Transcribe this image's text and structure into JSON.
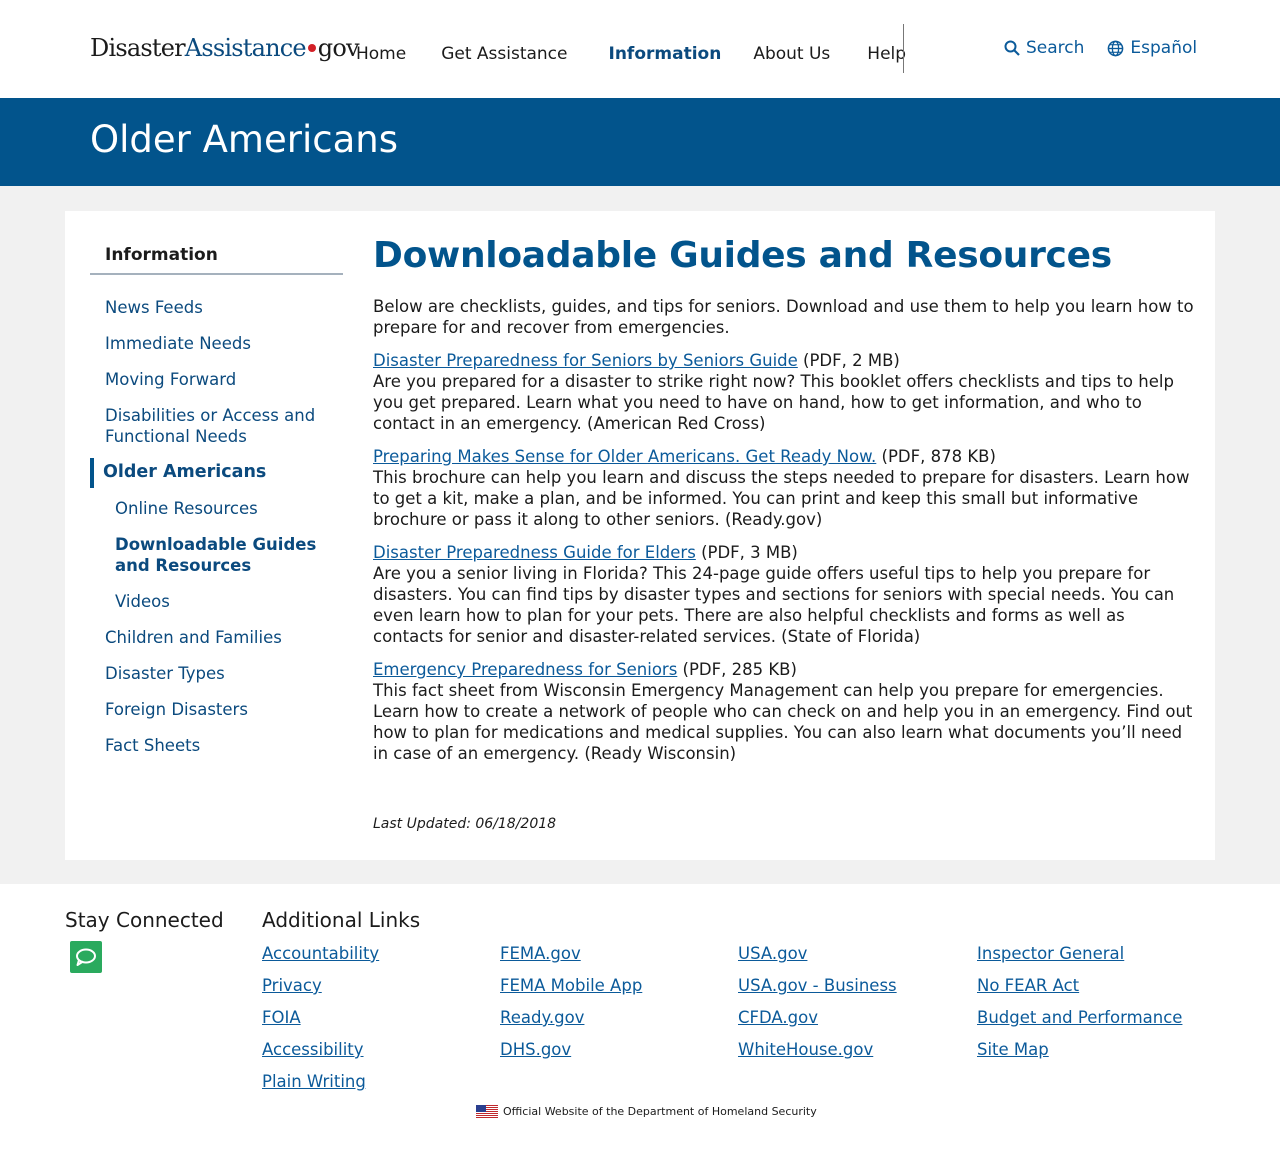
{
  "header": {
    "logo": {
      "part1": "Disaster",
      "part2": "Assistance",
      "part3": "gov"
    },
    "nav": [
      "Home",
      "Get Assistance",
      "Information",
      "About Us",
      "Help"
    ],
    "active_nav": "Information",
    "search_label": "Search",
    "language_label": "Español"
  },
  "banner": {
    "title": "Older Americans"
  },
  "sidebar": {
    "heading": "Information",
    "items": [
      {
        "label": "News Feeds"
      },
      {
        "label": "Immediate Needs"
      },
      {
        "label": "Moving Forward"
      },
      {
        "label": "Disabilities or Access and Functional Needs"
      },
      {
        "label": "Older Americans"
      },
      {
        "label": "Online Resources"
      },
      {
        "label": "Downloadable Guides and Resources"
      },
      {
        "label": "Videos"
      },
      {
        "label": "Children and Families"
      },
      {
        "label": "Disaster Types"
      },
      {
        "label": "Foreign Disasters"
      },
      {
        "label": "Fact Sheets"
      }
    ]
  },
  "main": {
    "title": "Downloadable Guides and Resources",
    "intro": "Below are checklists, guides, and tips for seniors. Download and use them to help you learn how to prepare for and recover from emergencies.",
    "resources": [
      {
        "link": "Disaster Preparedness for Seniors by Seniors Guide",
        "meta": "(PDF, 2 MB)",
        "desc": "Are you prepared for a disaster to strike right now? This booklet offers checklists and tips to help you get prepared. Learn what you need to have on hand, how to get information, and who to contact in an emergency. (American Red Cross)"
      },
      {
        "link": "Preparing Makes Sense for Older Americans. Get Ready Now.",
        "meta": "(PDF, 878 KB)",
        "desc": "This brochure can help you learn and discuss the steps needed to prepare for disasters. Learn how to get a kit, make a plan, and be informed. You can print and keep this small but informative brochure or pass it along to other seniors. (Ready.gov)"
      },
      {
        "link": "Disaster Preparedness Guide for Elders",
        "meta": "(PDF, 3 MB)",
        "desc": "Are you a senior living in Florida? This 24-page guide offers useful tips to help you prepare for disasters. You can find tips by disaster types and sections for seniors with special needs. You can even learn how to plan for your pets. There are also helpful checklists and forms as well as contacts for senior and disaster-related services. (State of Florida)"
      },
      {
        "link": "Emergency Preparedness for Seniors",
        "meta": "(PDF, 285 KB)",
        "desc": "This fact sheet from Wisconsin Emergency Management can help you prepare for emergencies. Learn how to create a network of people who can check on and help you in an emergency. Find out how to plan for medications and medical supplies. You can also learn what documents you’ll need in case of an emergency. (Ready Wisconsin)"
      }
    ],
    "last_updated": "Last Updated: 06/18/2018"
  },
  "footer": {
    "stay_connected": "Stay Connected",
    "additional_links": "Additional Links",
    "columns": [
      [
        "Accountability",
        "Privacy",
        "FOIA",
        "Accessibility",
        "Plain Writing"
      ],
      [
        "FEMA.gov",
        "FEMA Mobile App",
        "Ready.gov",
        "DHS.gov"
      ],
      [
        "USA.gov",
        "USA.gov - Business",
        "CFDA.gov",
        "WhiteHouse.gov"
      ],
      [
        "Inspector General",
        "No FEAR Act",
        "Budget and Performance",
        "Site Map"
      ]
    ],
    "official": "Official Website of the Department of Homeland Security"
  },
  "colors": {
    "brand_blue": "#02548c",
    "link_blue": "#0b5a9a",
    "accent_red": "#d32027",
    "chat_green": "#2aaa5e"
  },
  "icons": {
    "search": "search-icon",
    "language": "globe-icon",
    "chat": "chat-icon",
    "flag": "us-flag-icon"
  }
}
